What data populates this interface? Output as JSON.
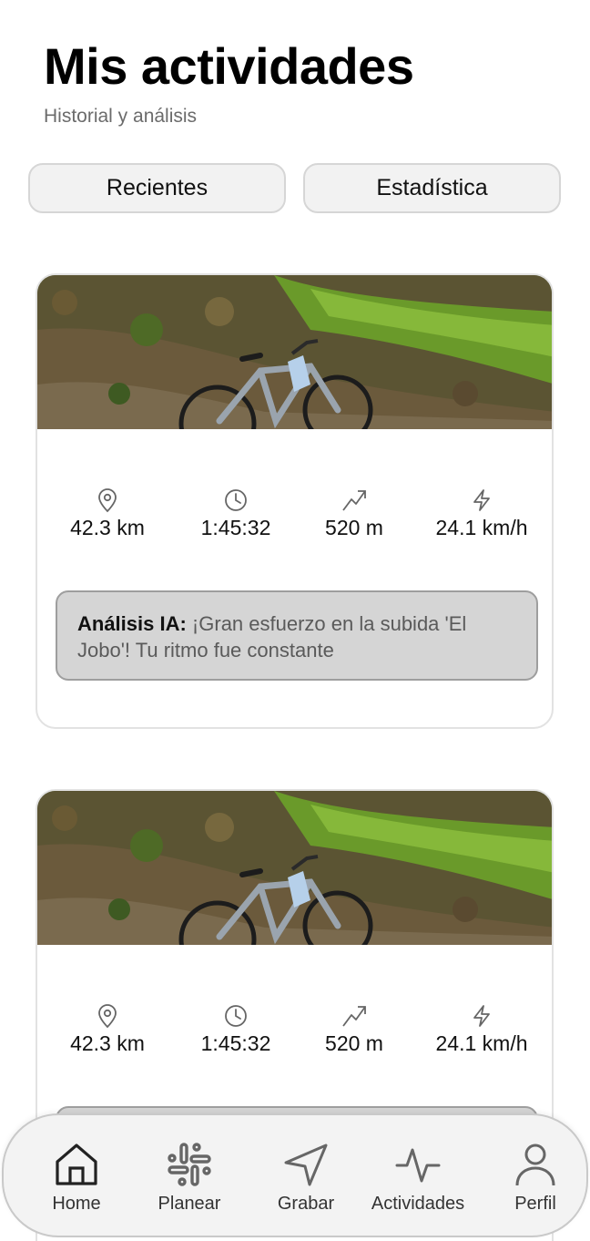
{
  "header": {
    "title": "Mis actividades",
    "subtitle": "Historial y análisis"
  },
  "tabs": [
    {
      "label": "Recientes"
    },
    {
      "label": "Estadística"
    }
  ],
  "activities": [
    {
      "image": "bike-on-trail-photo",
      "stats": {
        "distance": "42.3 km",
        "duration": "1:45:32",
        "elevation": "520 m",
        "speed": "24.1 km/h"
      },
      "ai_label": "Análisis IA:",
      "ai_text": " ¡Gran esfuerzo en la subida 'El Jobo'! Tu ritmo fue constante"
    },
    {
      "image": "bike-on-trail-photo",
      "stats": {
        "distance": "42.3 km",
        "duration": "1:45:32",
        "elevation": "520 m",
        "speed": "24.1 km/h"
      }
    }
  ],
  "nav": {
    "items": [
      {
        "label": "Home",
        "icon": "home-icon"
      },
      {
        "label": "Planear",
        "icon": "hashtag-icon"
      },
      {
        "label": "Grabar",
        "icon": "navigation-arrow-icon"
      },
      {
        "label": "Actividades",
        "icon": "activity-pulse-icon"
      },
      {
        "label": "Perfil",
        "icon": "user-icon"
      }
    ]
  }
}
